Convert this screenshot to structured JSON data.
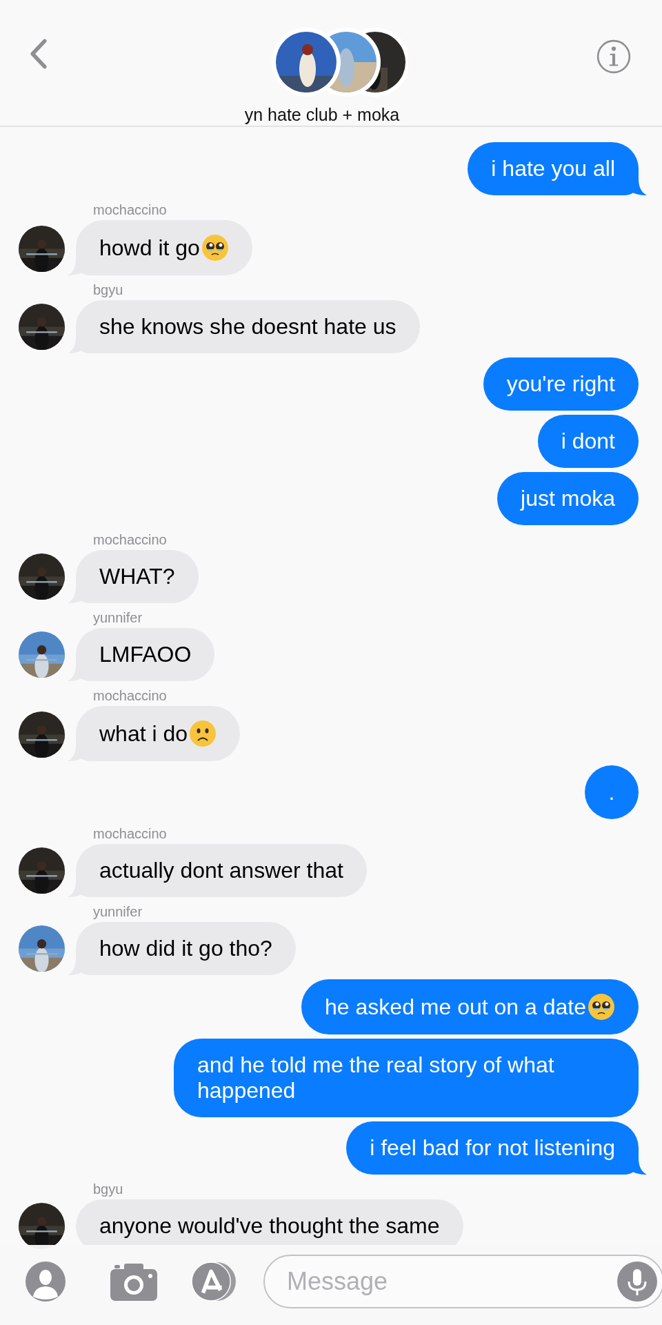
{
  "header": {
    "title": "yn hate club + moka"
  },
  "messages": [
    {
      "kind": "outgoing",
      "text": "i hate you all",
      "tail": true
    },
    {
      "kind": "incoming",
      "sender": "mochaccino",
      "text": "howd it go",
      "emoji": {
        "kind": "pleading"
      },
      "tail": true
    },
    {
      "kind": "incoming",
      "sender": "bgyu",
      "text": "she knows she doesnt hate us",
      "tail": true
    },
    {
      "kind": "outgoing",
      "text": "you're right",
      "tail": false
    },
    {
      "kind": "outgoing",
      "text": "i dont",
      "tail": false
    },
    {
      "kind": "outgoing",
      "text": "just moka",
      "tail": false
    },
    {
      "kind": "incoming",
      "sender": "mochaccino",
      "text": "WHAT?",
      "tail": true
    },
    {
      "kind": "incoming",
      "sender": "yunnifer",
      "text": "LMFAOO",
      "tail": true
    },
    {
      "kind": "incoming",
      "sender": "mochaccino",
      "text": "what i do",
      "emoji": {
        "kind": "frowning"
      },
      "tail": true
    },
    {
      "kind": "outgoing",
      "text": ".",
      "tail": false
    },
    {
      "kind": "incoming",
      "sender": "mochaccino",
      "text": "actually dont answer that",
      "tail": true
    },
    {
      "kind": "incoming",
      "sender": "yunnifer",
      "text": "how did it go tho?",
      "tail": true
    },
    {
      "kind": "outgoing",
      "text": "he asked me out on a date",
      "emoji": {
        "kind": "pleading"
      },
      "tail": false
    },
    {
      "kind": "outgoing",
      "text": "and he told me the real story of what happened",
      "tail": false
    },
    {
      "kind": "outgoing",
      "text": "i feel bad for not listening",
      "tail": true
    },
    {
      "kind": "incoming",
      "sender": "bgyu",
      "text": "anyone would've thought the same",
      "tail": false
    }
  ],
  "composer": {
    "placeholder": "Message"
  }
}
